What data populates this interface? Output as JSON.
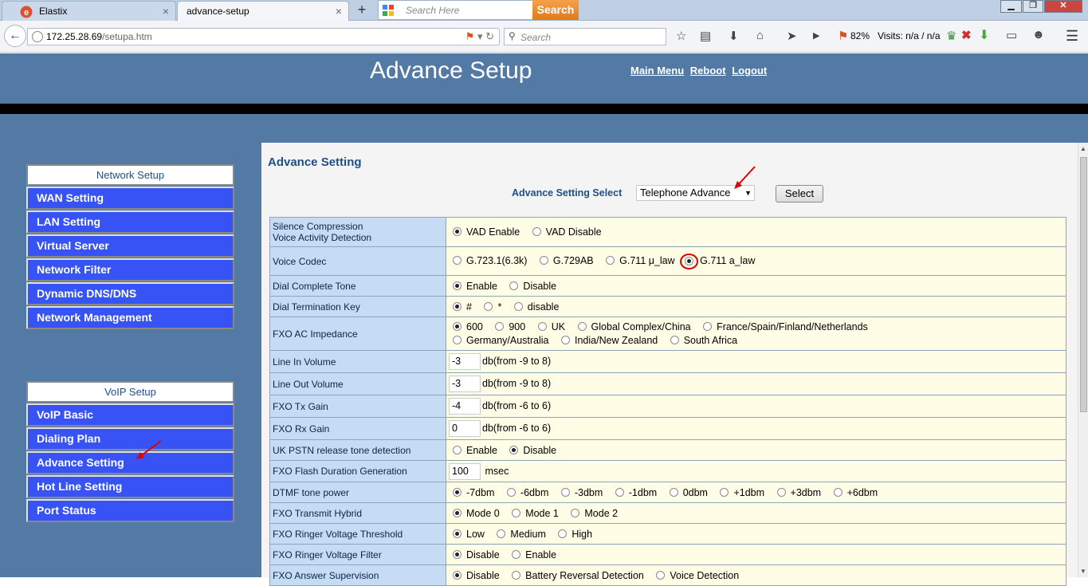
{
  "browser": {
    "tabs": [
      {
        "title": "Elastix",
        "close": "×"
      },
      {
        "title": "advance-setup",
        "close": "×"
      }
    ],
    "new_tab": "+",
    "search_tab_placeholder": "Search Here",
    "search_button": "Search",
    "window_buttons": {
      "minimize": "▁",
      "maximize": "❐",
      "close": "✕"
    },
    "url_host": "172.25.28.69",
    "url_path": "/setupa.htm",
    "search_placeholder": "Search",
    "zoom": "82%",
    "visits": "Visits: n/a / n/a"
  },
  "header": {
    "title": "Advance Setup",
    "links": [
      "Main Menu",
      "Reboot",
      "Logout"
    ]
  },
  "sidebar": {
    "network": {
      "heading": "Network Setup",
      "items": [
        "WAN Setting",
        "LAN Setting",
        "Virtual Server",
        "Network Filter",
        "Dynamic DNS/DNS",
        "Network Management"
      ]
    },
    "voip": {
      "heading": "VoIP Setup",
      "items": [
        "VoIP Basic",
        "Dialing Plan",
        "Advance Setting",
        "Hot Line Setting",
        "Port Status"
      ]
    }
  },
  "main": {
    "title": "Advance Setting",
    "select_label": "Advance Setting Select",
    "select_value": "Telephone Advance",
    "select_button": "Select",
    "rows": [
      {
        "label1": "Silence Compression",
        "label2": "Voice Activity Detection",
        "options": [
          "VAD Enable",
          "VAD Disable"
        ],
        "selected": 0
      },
      {
        "label": "Voice Codec",
        "options": [
          "G.723.1(6.3k)",
          "G.729AB",
          "G.711 μ_law",
          "G.711 a_law"
        ],
        "selected": 3
      },
      {
        "label": "Dial Complete Tone",
        "options": [
          "Enable",
          "Disable"
        ],
        "selected": 0
      },
      {
        "label": "Dial Termination Key",
        "options": [
          "#",
          "*",
          "disable"
        ],
        "selected": 0
      },
      {
        "label": "FXO AC Impedance",
        "options_line1": [
          "600",
          "900",
          "UK",
          "Global Complex/China",
          "France/Spain/Finland/Netherlands"
        ],
        "options_line2": [
          "Germany/Australia",
          "India/New Zealand",
          "South Africa"
        ],
        "selected": 0
      },
      {
        "label": "Line In Volume",
        "value": "-3",
        "unit": "db(from -9 to 8)"
      },
      {
        "label": "Line Out Volume",
        "value": "-3",
        "unit": "db(from -9 to 8)"
      },
      {
        "label": "FXO Tx Gain",
        "value": "-4",
        "unit": "db(from -6 to 6)"
      },
      {
        "label": "FXO Rx Gain",
        "value": "0",
        "unit": "db(from -6 to 6)"
      },
      {
        "label": "UK PSTN release tone detection",
        "options": [
          "Enable",
          "Disable"
        ],
        "selected": 1
      },
      {
        "label": "FXO Flash Duration Generation",
        "value": "100",
        "unit": "msec"
      },
      {
        "label": "DTMF tone power",
        "options": [
          "-7dbm",
          "-6dbm",
          "-3dbm",
          "-1dbm",
          "0dbm",
          "+1dbm",
          "+3dbm",
          "+6dbm"
        ],
        "selected": 0
      },
      {
        "label": "FXO Transmit Hybrid",
        "options": [
          "Mode 0",
          "Mode 1",
          "Mode 2"
        ],
        "selected": 0
      },
      {
        "label": "FXO Ringer Voltage Threshold",
        "options": [
          "Low",
          "Medium",
          "High"
        ],
        "selected": 0
      },
      {
        "label": "FXO Ringer Voltage Filter",
        "options": [
          "Disable",
          "Enable"
        ],
        "selected": 0
      },
      {
        "label": "FXO Answer Supervision",
        "options": [
          "Disable",
          "Battery Reversal Detection",
          "Voice Detection"
        ],
        "selected": 0
      }
    ]
  },
  "colors": {
    "header_bg": "#527aa5",
    "nav_item_bg": "#3753f5",
    "label_cell_bg": "#c6dcf5",
    "value_cell_bg": "#fffde6",
    "annotation": "#e00000"
  }
}
